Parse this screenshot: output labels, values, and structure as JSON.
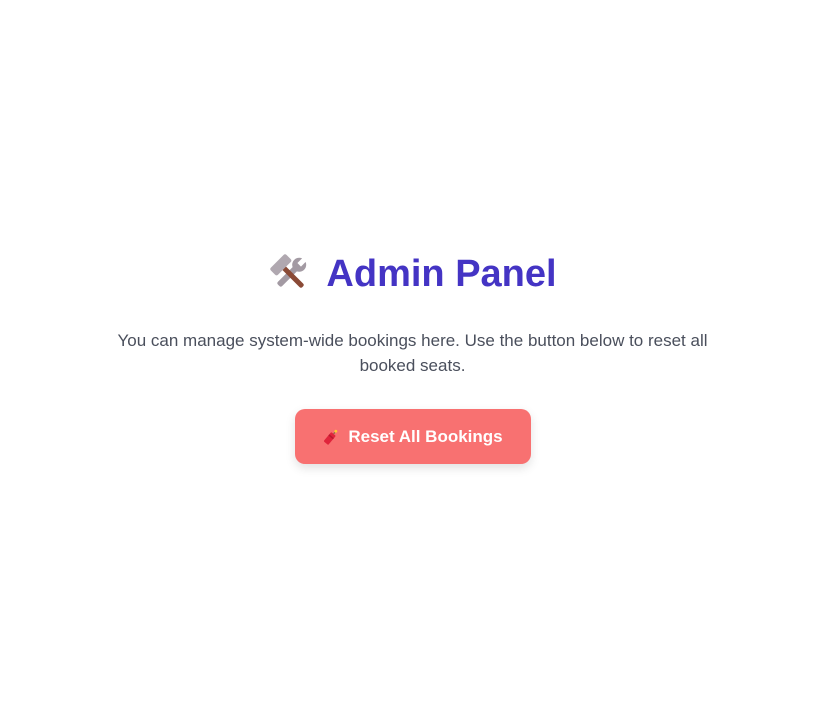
{
  "admin_panel": {
    "title": "Admin Panel",
    "title_icon": "hammer-and-wrench-icon",
    "description": "You can manage system-wide bookings here. Use the button below to reset all booked seats.",
    "reset_button": {
      "label": "Reset All Bookings",
      "icon": "firecracker-icon"
    }
  },
  "colors": {
    "title": "#4434c4",
    "button_bg": "#f87171",
    "button_text": "#ffffff",
    "description_text": "#4a4f5c"
  }
}
